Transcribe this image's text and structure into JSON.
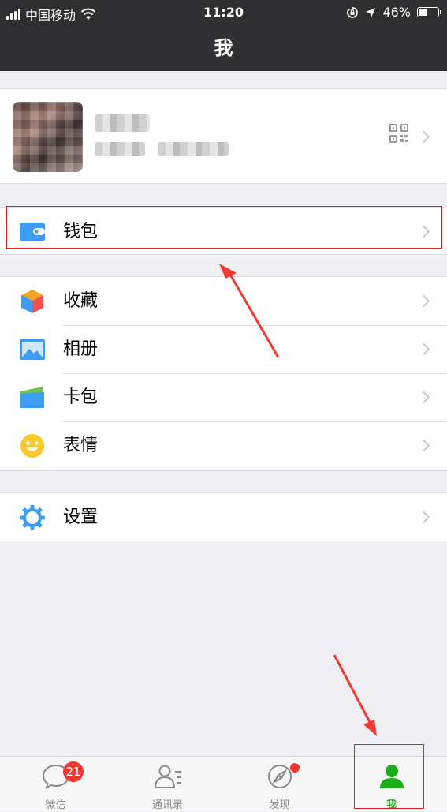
{
  "status_bar": {
    "carrier": "中国移动",
    "time": "11:20",
    "battery": "46%",
    "battery_level": 0.46
  },
  "nav": {
    "title": "我"
  },
  "menu": {
    "wallet": "钱包",
    "favorites": "收藏",
    "album": "相册",
    "cards": "卡包",
    "stickers": "表情",
    "settings": "设置"
  },
  "tabbar": {
    "tabs": [
      {
        "label": "微信",
        "badge": "21"
      },
      {
        "label": "通讯录"
      },
      {
        "label": "发现"
      },
      {
        "label": "我"
      }
    ]
  },
  "colors": {
    "nav_bg": "#2f2f31",
    "accent_green": "#1aad19",
    "badge_red": "#f43530",
    "annotation_red": "#e02020"
  }
}
